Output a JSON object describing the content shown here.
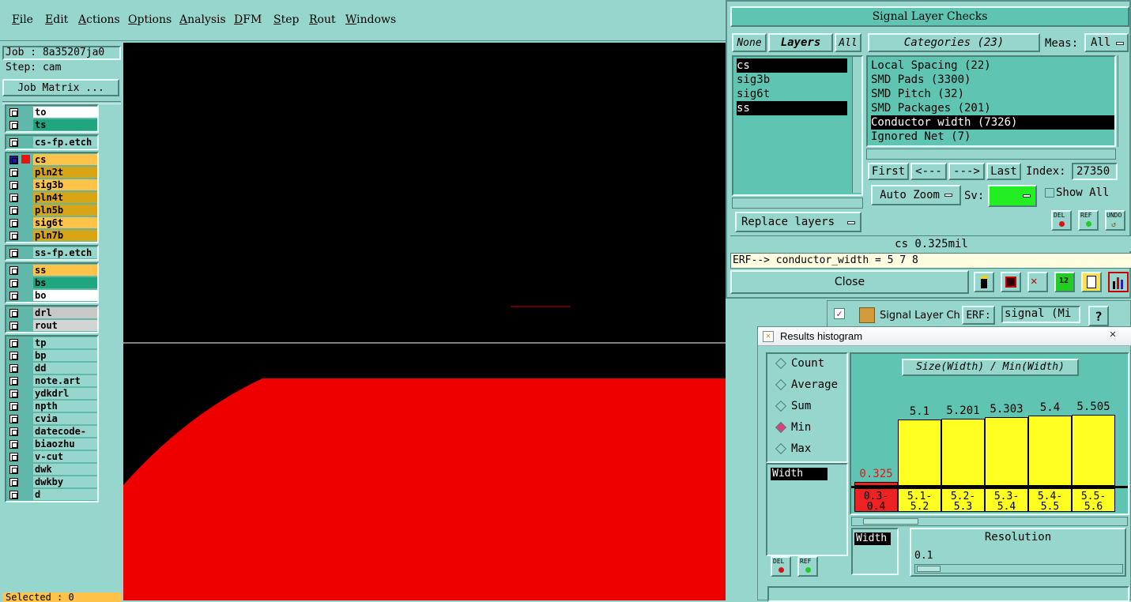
{
  "menu": [
    "File",
    "Edit",
    "Actions",
    "Options",
    "Analysis",
    "DFM",
    "Step",
    "Rout",
    "Windows"
  ],
  "job": {
    "job_label": "Job : 8a35207ja0",
    "step_label": "Step: cam",
    "matrix_button": "Job Matrix ..."
  },
  "layers": [
    {
      "group": 1,
      "items": [
        {
          "name": "to",
          "color": "#ffffff"
        },
        {
          "name": "ts",
          "color": "#1fa67f"
        }
      ]
    },
    {
      "group": 2,
      "items": [
        {
          "name": "cs-fp.etch",
          "color": "#96d6cd"
        }
      ]
    },
    {
      "group": 3,
      "items": [
        {
          "name": "cs",
          "color": "#ffc34a"
        },
        {
          "name": "pln2t",
          "color": "#d9a514"
        },
        {
          "name": "sig3b",
          "color": "#ffc34a"
        },
        {
          "name": "pln4t",
          "color": "#d9a514"
        },
        {
          "name": "pln5b",
          "color": "#d9a514"
        },
        {
          "name": "sig6t",
          "color": "#ffc34a"
        },
        {
          "name": "pln7b",
          "color": "#d9a514"
        }
      ]
    },
    {
      "group": 4,
      "items": [
        {
          "name": "ss-fp.etch",
          "color": "#96d6cd"
        }
      ]
    },
    {
      "group": 5,
      "items": [
        {
          "name": "ss",
          "color": "#ffc34a"
        },
        {
          "name": "bs",
          "color": "#1fa67f"
        },
        {
          "name": "bo",
          "color": "#ffffff"
        }
      ]
    },
    {
      "group": 6,
      "items": [
        {
          "name": "drl",
          "color": "#c8c8c8"
        },
        {
          "name": "rout",
          "color": "#d4d4d4"
        }
      ]
    },
    {
      "group": 7,
      "items": [
        {
          "name": "tp",
          "color": "#96d6cd"
        },
        {
          "name": "bp",
          "color": "#96d6cd"
        },
        {
          "name": "dd",
          "color": "#96d6cd"
        },
        {
          "name": "note.art",
          "color": "#96d6cd"
        },
        {
          "name": "ydkdrl",
          "color": "#96d6cd"
        },
        {
          "name": "npth",
          "color": "#96d6cd"
        },
        {
          "name": "cvia",
          "color": "#96d6cd"
        },
        {
          "name": "datecode-to",
          "color": "#96d6cd"
        },
        {
          "name": "biaozhu",
          "color": "#96d6cd"
        },
        {
          "name": "v-cut",
          "color": "#96d6cd"
        },
        {
          "name": "dwk",
          "color": "#96d6cd"
        },
        {
          "name": "dwkby",
          "color": "#96d6cd"
        },
        {
          "name": "d",
          "color": "#96d6cd"
        }
      ]
    }
  ],
  "selected_label": "Selected : 0",
  "slc": {
    "title": "Signal Layer Checks",
    "none_btn": "None",
    "layers_btn": "Layers",
    "all_btn": "All",
    "layer_list": [
      "cs",
      "sig3b",
      "sig6t",
      "ss"
    ],
    "categories_btn": "Categories (23)",
    "meas_label": "Meas:",
    "meas_value": "All",
    "categories": [
      "Local Spacing (22)",
      "SMD Pads (3300)",
      "SMD Pitch (32)",
      "SMD Packages (201)",
      "Conductor width (7326)",
      "Ignored Net (7)"
    ],
    "first": "First",
    "prev": "<---",
    "next": "--->",
    "last": "Last",
    "index_label": "Index:",
    "index_value": "27350",
    "auto_zoom": "Auto Zoom",
    "sv_label": "Sv:",
    "show_all": "Show All",
    "replace_layers": "Replace layers",
    "del": "DEL",
    "ref": "REF",
    "undo": "UNDO",
    "status": "cs 0.325mil",
    "erf_line": "ERF--> conductor_width = 5 7 8",
    "close": "Close"
  },
  "bg_window": {
    "title": "Signal Layer Ch",
    "erf": "ERF:",
    "field": "signal (Mi",
    "help": "?"
  },
  "hist": {
    "title": "Results histogram",
    "radios": [
      {
        "label": "Count",
        "on": false
      },
      {
        "label": "Average",
        "on": false
      },
      {
        "label": "Sum",
        "on": false
      },
      {
        "label": "Min",
        "on": true
      },
      {
        "label": "Max",
        "on": false
      }
    ],
    "attr_list": [
      "Width"
    ],
    "chart_title": "Size(Width) / Min(Width)",
    "attr2": "Width",
    "resolution_label": "Resolution",
    "resolution_value": "0.1",
    "del": "DEL",
    "ref": "REF"
  },
  "chart_data": {
    "type": "bar",
    "title": "Size(Width) / Min(Width)",
    "categories": [
      "0.3-\n0.4",
      "5.1-\n5.2",
      "5.2-\n5.3",
      "5.3-\n5.4",
      "5.4-\n5.5",
      "5.5-\n5.6"
    ],
    "values": [
      0.325,
      5.1,
      5.201,
      5.303,
      5.4,
      5.505
    ],
    "labels": [
      "0.325",
      "5.1",
      "5.201",
      "5.303",
      "5.4",
      "5.505"
    ],
    "colors": [
      "#ee2222",
      "#ffff22",
      "#ffff22",
      "#ffff22",
      "#ffff22",
      "#ffff22"
    ],
    "ylim": [
      0,
      6.2
    ]
  }
}
